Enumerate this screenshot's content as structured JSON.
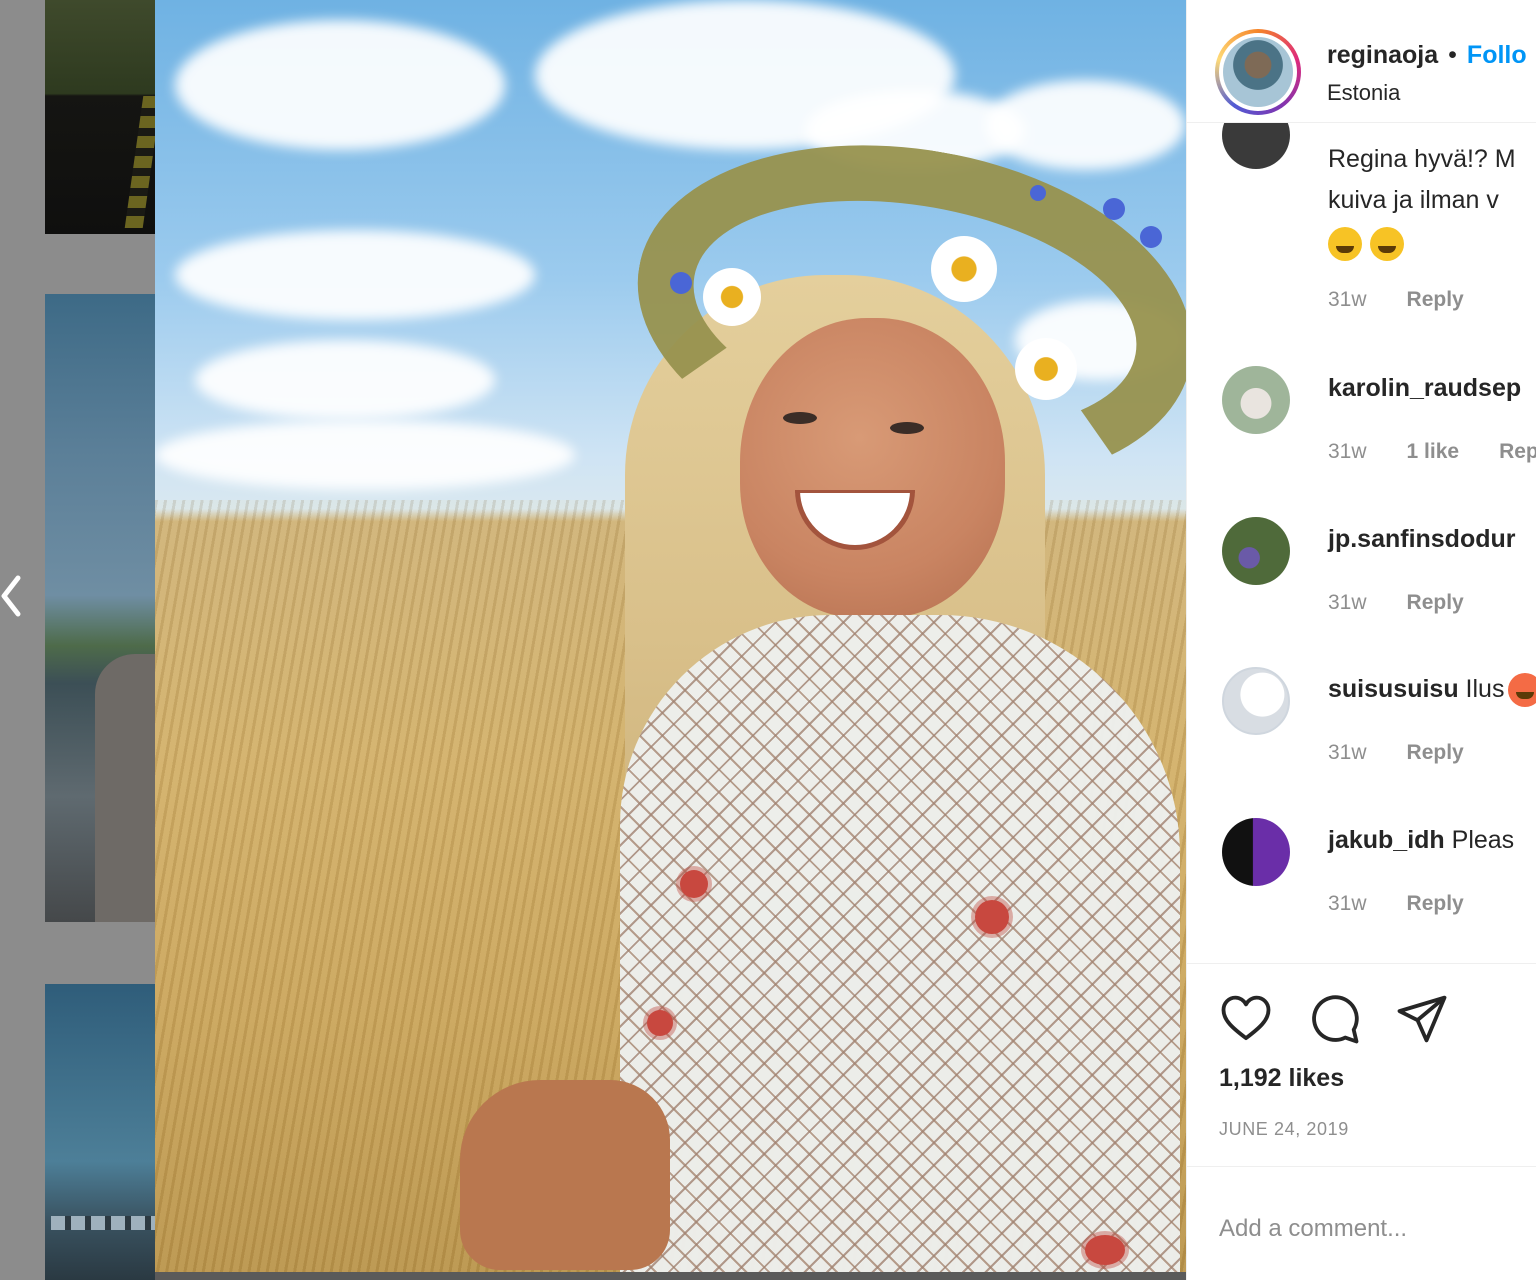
{
  "post": {
    "username": "reginaoja",
    "separator": "•",
    "follow_label": "Follo",
    "location": "Estonia"
  },
  "comments": [
    {
      "username": "",
      "text_line1": "Regina hyvä!? M",
      "text_line2": "kuiva ja ilman v",
      "emoji_names": [
        "thinking-face",
        "grinning-face"
      ],
      "time": "31w",
      "likes": "",
      "reply_label": "Reply"
    },
    {
      "username": "karolin_raudsep",
      "text": "",
      "time": "31w",
      "likes": "1 like",
      "reply_label": "Rep"
    },
    {
      "username": "jp.sanfinsdodur",
      "text": "",
      "time": "31w",
      "likes": "",
      "reply_label": "Reply"
    },
    {
      "username": "suisusuisu",
      "text": "Ilus",
      "time": "31w",
      "likes": "",
      "reply_label": "Reply"
    },
    {
      "username": "jakub_idh",
      "text": "Pleas",
      "time": "31w",
      "likes": "",
      "reply_label": "Reply"
    }
  ],
  "actions": {
    "like_icon": "heart-icon",
    "comment_icon": "comment-icon",
    "share_icon": "paper-plane-icon"
  },
  "likes_count": "1,192 likes",
  "date": "JUNE 24, 2019",
  "comment_placeholder": "Add a comment...",
  "nav": {
    "prev_icon": "chevron-left-icon"
  },
  "colors": {
    "link": "#0095f6",
    "text": "#262626",
    "muted": "#8e8e8e",
    "divider": "#efefef"
  }
}
